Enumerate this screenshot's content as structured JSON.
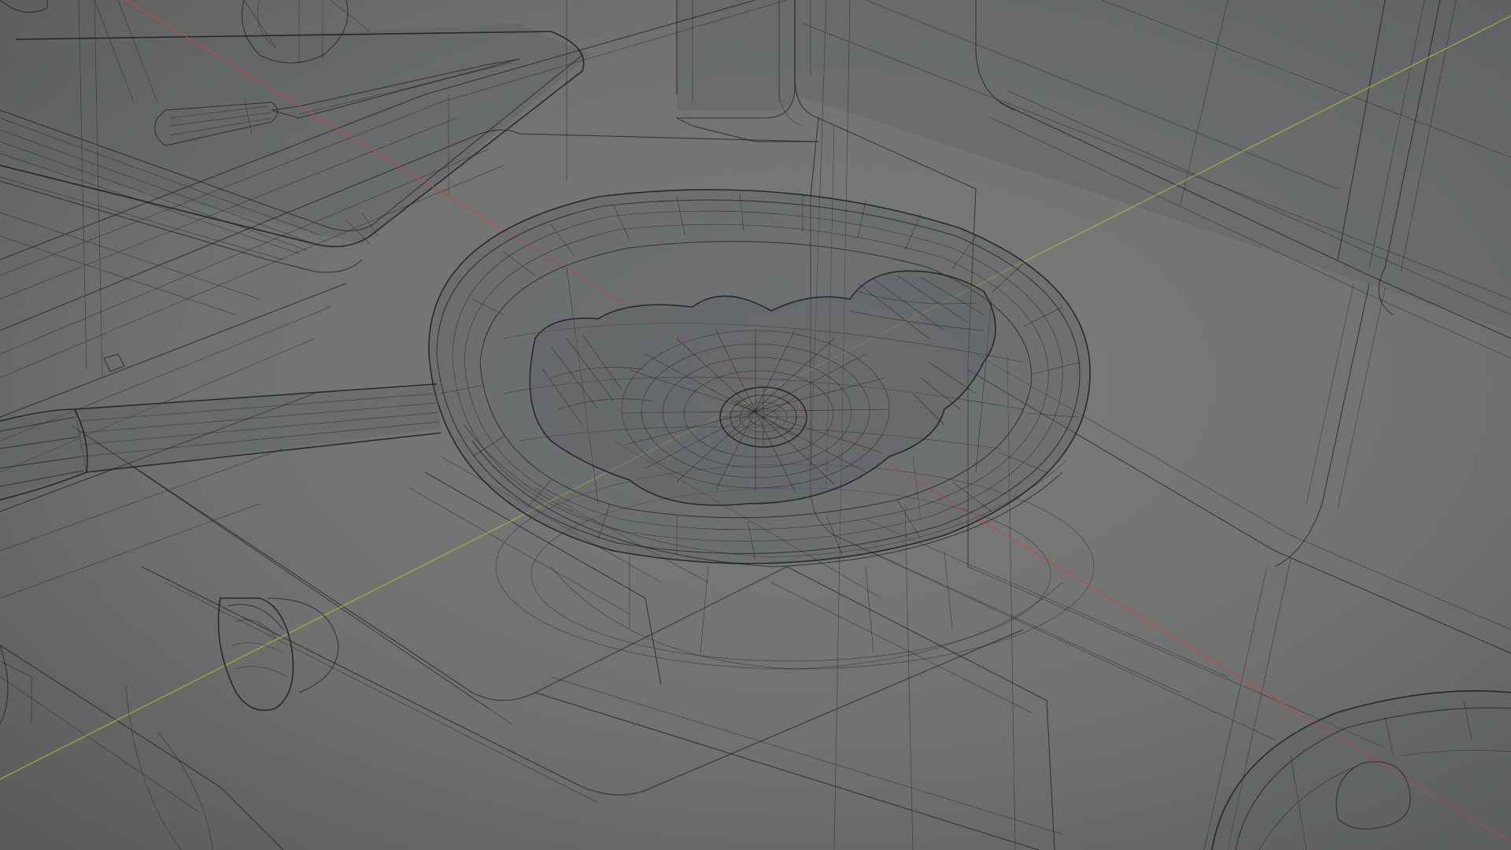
{
  "viewport": {
    "mode": "wireframe-xray",
    "background_color": "#6f7171",
    "highlight_color": "#9a9c9c",
    "wire_color": "#1c1d1e",
    "axis_x_color": "#c8474b",
    "axis_y_color": "#a2b940"
  },
  "scene_objects": [
    "frying-pan",
    "fried-egg",
    "pan-handle",
    "cutting-board",
    "knife",
    "stove-knob",
    "countertop",
    "wall-tiles",
    "second-pan"
  ]
}
